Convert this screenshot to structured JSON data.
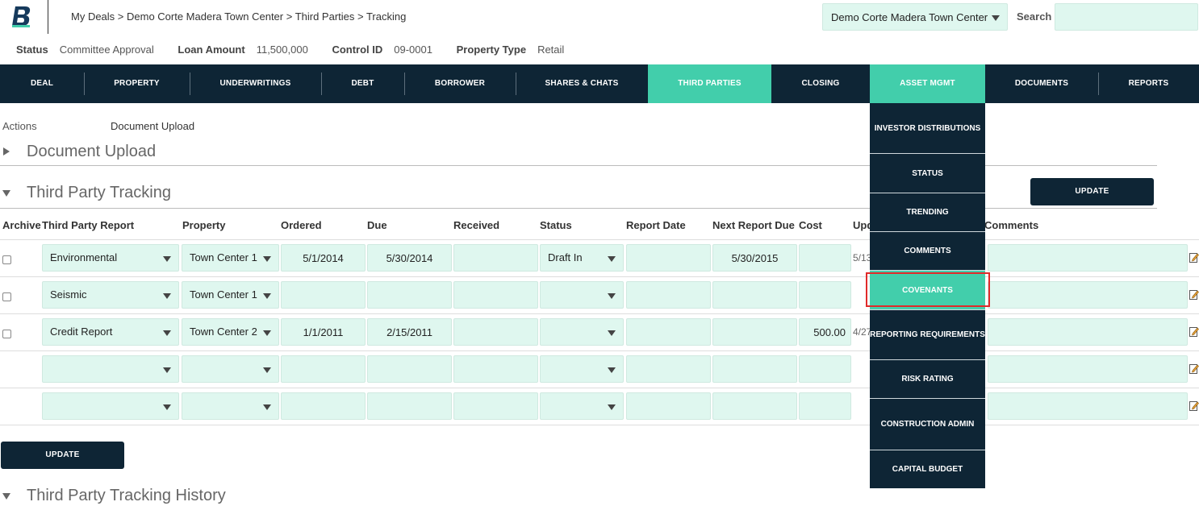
{
  "header": {
    "breadcrumb": "My Deals > Demo Corte Madera Town Center > Third Parties > Tracking",
    "deal_select": "Demo Corte Madera Town Center",
    "search_label": "Search",
    "search_value": ""
  },
  "info": [
    {
      "label": "Status",
      "value": "Committee Approval"
    },
    {
      "label": "Loan Amount",
      "value": "11,500,000"
    },
    {
      "label": "Control ID",
      "value": "09-0001"
    },
    {
      "label": "Property Type",
      "value": "Retail"
    }
  ],
  "nav": [
    "DEAL",
    "PROPERTY",
    "UNDERWRITINGS",
    "DEBT",
    "BORROWER",
    "SHARES & CHATS",
    "THIRD PARTIES",
    "CLOSING",
    "ASSET MGMT",
    "DOCUMENTS",
    "REPORTS"
  ],
  "dropdown": [
    "INVESTOR DISTRIBUTIONS",
    "STATUS",
    "TRENDING",
    "COMMENTS",
    "COVENANTS",
    "REPORTING REQUIREMENTS",
    "RISK RATING",
    "CONSTRUCTION ADMIN",
    "CAPITAL BUDGET"
  ],
  "actions_label": "Actions",
  "actions_value": "Document Upload",
  "sections": {
    "upload": "Document Upload",
    "tracking": "Third Party Tracking",
    "history": "Third Party Tracking History"
  },
  "update_label": "UPDATE",
  "columns": [
    "Archive",
    "Third Party Report",
    "Property",
    "Ordered",
    "Due",
    "Received",
    "Status",
    "Report Date",
    "Next Report Due",
    "Cost",
    "Upd",
    "Comments"
  ],
  "rows": [
    {
      "report": "Environmental",
      "property": "Town Center 1",
      "ordered": "5/1/2014",
      "due": "5/30/2014",
      "received": "",
      "status": "Draft In",
      "report_date": "",
      "next_due": "5/30/2015",
      "cost": "",
      "updated": "5/13"
    },
    {
      "report": "Seismic",
      "property": "Town Center 1",
      "ordered": "",
      "due": "",
      "received": "",
      "status": "",
      "report_date": "",
      "next_due": "",
      "cost": "",
      "updated": ""
    },
    {
      "report": "Credit Report",
      "property": "Town Center 2",
      "ordered": "1/1/2011",
      "due": "2/15/2011",
      "received": "",
      "status": "",
      "report_date": "",
      "next_due": "",
      "cost": "500.00",
      "updated": "4/27"
    },
    {
      "report": "",
      "property": "",
      "ordered": "",
      "due": "",
      "received": "",
      "status": "",
      "report_date": "",
      "next_due": "",
      "cost": "",
      "updated": ""
    },
    {
      "report": "",
      "property": "",
      "ordered": "",
      "due": "",
      "received": "",
      "status": "",
      "report_date": "",
      "next_due": "",
      "cost": "",
      "updated": ""
    }
  ]
}
